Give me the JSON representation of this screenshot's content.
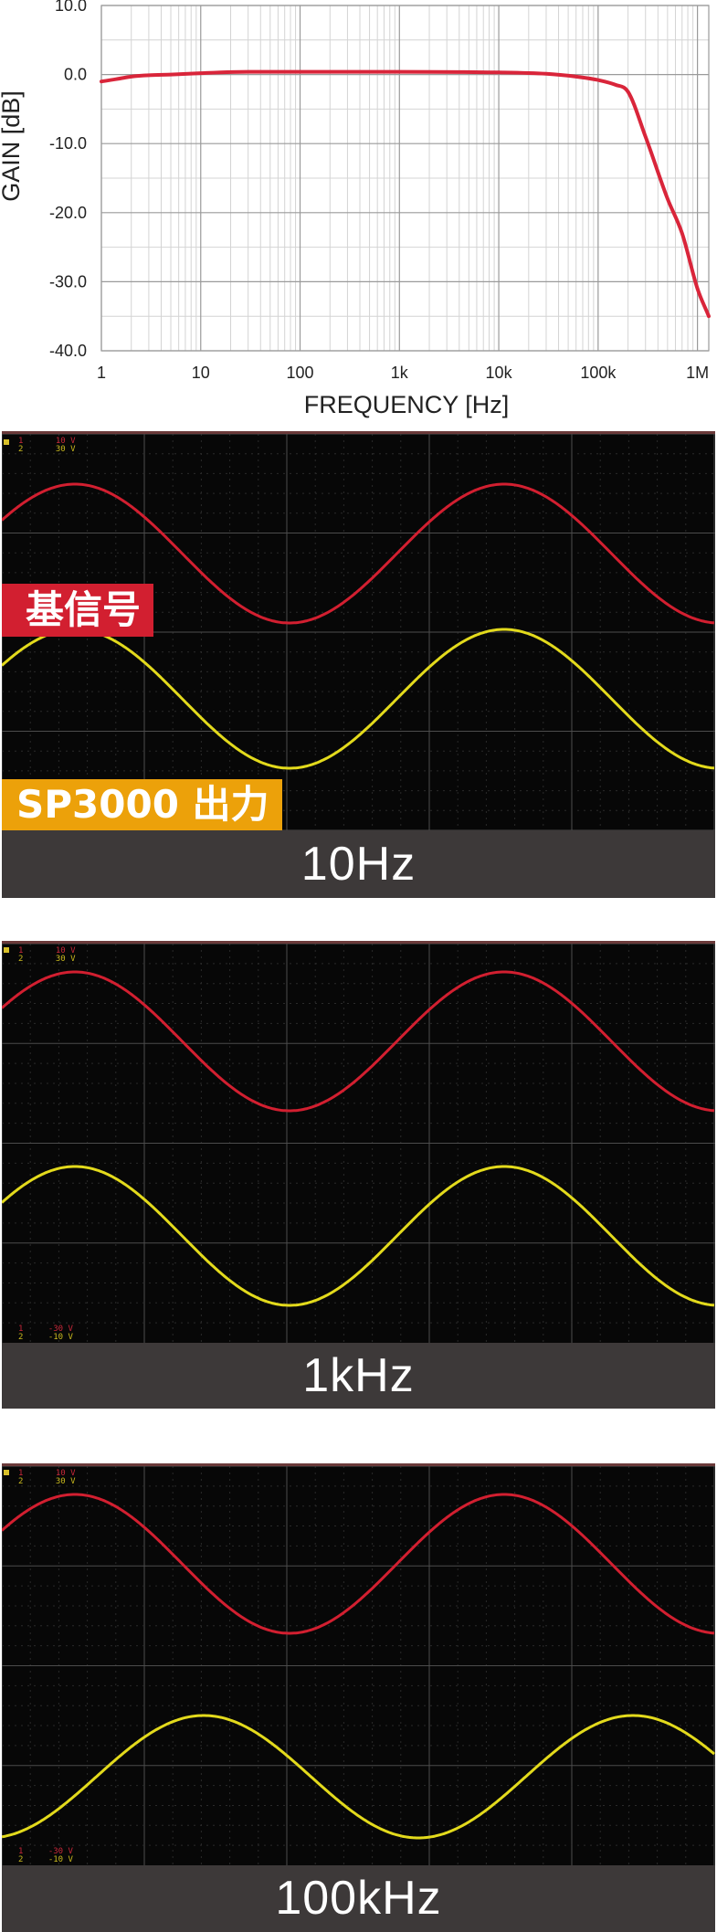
{
  "chart_data": {
    "type": "line",
    "title": "",
    "xlabel": "FREQUENCY [Hz]",
    "ylabel": "GAIN [dB]",
    "x_scale": "log",
    "xlim": [
      1,
      1300000
    ],
    "ylim": [
      -40,
      10
    ],
    "grid": true,
    "x_ticks": [
      {
        "value": 1,
        "label": "1"
      },
      {
        "value": 10,
        "label": "10"
      },
      {
        "value": 100,
        "label": "100"
      },
      {
        "value": 1000,
        "label": "1k"
      },
      {
        "value": 10000,
        "label": "10k"
      },
      {
        "value": 100000,
        "label": "100k"
      },
      {
        "value": 1000000,
        "label": "1M"
      }
    ],
    "y_ticks": [
      {
        "value": 10,
        "label": "10.0"
      },
      {
        "value": 0,
        "label": "0.0"
      },
      {
        "value": -10,
        "label": "-10.0"
      },
      {
        "value": -20,
        "label": "-20.0"
      },
      {
        "value": -30,
        "label": "-30.0"
      },
      {
        "value": -40,
        "label": "-40.0"
      }
    ],
    "series": [
      {
        "color": "#d9253a",
        "x": [
          1,
          1.5,
          2,
          3,
          5,
          10,
          30,
          100,
          1000,
          10000,
          30000,
          60000,
          100000,
          150000,
          200000,
          300000,
          500000,
          700000,
          1000000,
          1300000
        ],
        "y": [
          -1.0,
          -0.6,
          -0.3,
          -0.1,
          0.0,
          0.2,
          0.4,
          0.4,
          0.4,
          0.3,
          0.1,
          -0.3,
          -0.8,
          -1.5,
          -2.5,
          -9,
          -18,
          -23,
          -31,
          -35
        ]
      }
    ]
  },
  "scopes": [
    {
      "caption": "10Hz",
      "badge_reference": "基信号",
      "badge_output": "SP3000 出力",
      "corner_top": [
        "1",
        "10 V",
        "2",
        "30 V"
      ],
      "corner_bottom": [],
      "colors": {
        "reference": "#d21f30",
        "output": "#e3da1c"
      }
    },
    {
      "caption": "1kHz",
      "badge_reference": "",
      "badge_output": "",
      "corner_top": [
        "1",
        "10 V",
        "2",
        "30 V"
      ],
      "corner_bottom": [
        "1",
        "-30 V",
        "2",
        "-10 V"
      ],
      "colors": {
        "reference": "#d21f30",
        "output": "#e3da1c"
      }
    },
    {
      "caption": "100kHz",
      "badge_reference": "",
      "badge_output": "",
      "corner_top": [
        "1",
        "10 V",
        "2",
        "30 V"
      ],
      "corner_bottom": [
        "1",
        "-30 V",
        "2",
        "-10 V"
      ],
      "colors": {
        "reference": "#d21f30",
        "output": "#e3da1c"
      }
    }
  ]
}
